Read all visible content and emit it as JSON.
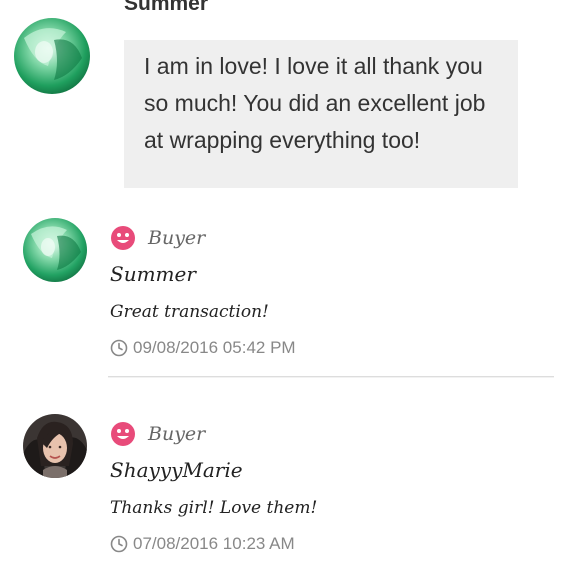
{
  "top_review": {
    "name": "Summer",
    "message": "I am in love! I love it all thank you so much! You did an excellent job at wrapping everything too!"
  },
  "feedback": [
    {
      "role": "Buyer",
      "username": "Summer",
      "comment": "Great transaction!",
      "date": "09/08/2016 05:42 PM"
    },
    {
      "role": "Buyer",
      "username": "ShayyyMarie",
      "comment": "Thanks girl! Love them!",
      "date": "07/08/2016 10:23 AM"
    }
  ],
  "colors": {
    "buyer_icon": "#e84b7a",
    "bubble_bg": "#efefef",
    "date_text": "#888888"
  },
  "icons": {
    "role": "smiley-face-icon",
    "date": "clock-icon"
  }
}
